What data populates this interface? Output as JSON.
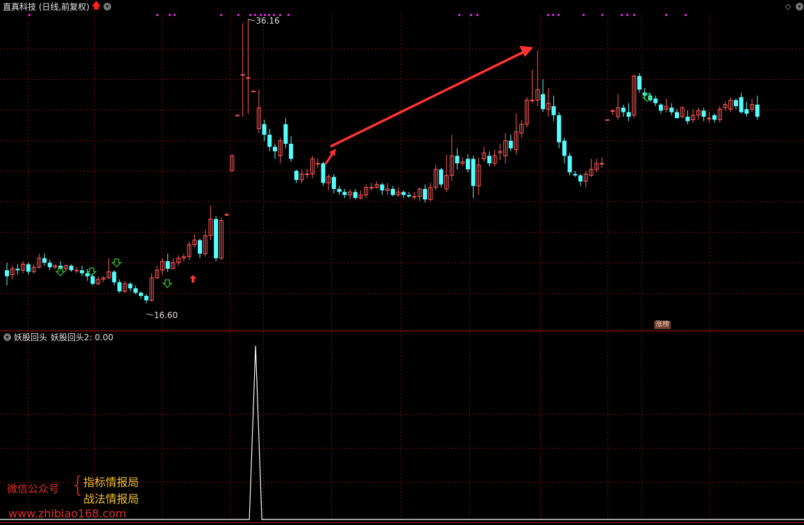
{
  "header": {
    "title": "直真科技 (日线,前复权)",
    "arrow_icon": "red-up-arrow-icon",
    "menu_icon": "circle-chevron-down-icon"
  },
  "subpanel": {
    "title": "妖股回头",
    "value_label": "妖股回头2: 0.00"
  },
  "badge": {
    "label": "涨榜"
  },
  "watermark": {
    "label": "微信公众号",
    "brace": "{",
    "line1": "指标情报局",
    "line2": "战法情报局",
    "url": "www.zhibiao168.com"
  },
  "colors": {
    "up": "#ff5a5a",
    "down": "#54ffff",
    "grid": "#7a1010",
    "separator": "#a01818",
    "arrow": "#ff3333",
    "dots": "#e020e0",
    "green_arrow": "#30d030"
  },
  "chart_data": [
    {
      "type": "candlestick",
      "title": "直真科技 (日线,前复权)",
      "ylim": [
        16.6,
        36.16
      ],
      "annotations": {
        "high": "36.16",
        "low": "16.60"
      },
      "candles": [
        [
          19.5,
          19.1,
          20.0,
          18.5
        ],
        [
          19.2,
          19.6,
          19.8,
          18.9
        ],
        [
          19.6,
          19.5,
          19.9,
          19.2
        ],
        [
          19.5,
          19.9,
          20.1,
          19.3
        ],
        [
          19.9,
          19.4,
          20.0,
          19.2
        ],
        [
          19.4,
          19.7,
          19.9,
          19.3
        ],
        [
          19.7,
          20.3,
          20.6,
          19.6
        ],
        [
          20.3,
          20.0,
          20.6,
          19.8
        ],
        [
          20.0,
          19.7,
          20.2,
          19.5
        ],
        [
          19.7,
          19.8,
          19.9,
          19.6
        ],
        [
          19.8,
          19.6,
          20.1,
          19.5
        ],
        [
          19.6,
          19.8,
          19.9,
          19.4
        ],
        [
          19.8,
          19.5,
          19.9,
          19.4
        ],
        [
          19.5,
          19.5,
          19.7,
          19.3
        ],
        [
          19.5,
          19.3,
          19.8,
          19.1
        ],
        [
          19.3,
          19.1,
          19.6,
          18.8
        ],
        [
          19.1,
          18.6,
          19.3,
          18.5
        ],
        [
          18.6,
          18.9,
          19.1,
          18.5
        ],
        [
          18.9,
          19.0,
          19.1,
          18.7
        ],
        [
          19.0,
          19.4,
          20.3,
          18.9
        ],
        [
          19.4,
          18.7,
          19.5,
          18.5
        ],
        [
          18.7,
          18.1,
          18.9,
          18.0
        ],
        [
          18.1,
          18.6,
          18.8,
          18.0
        ],
        [
          18.6,
          18.3,
          18.7,
          18.1
        ],
        [
          18.3,
          18.0,
          18.5,
          17.9
        ],
        [
          18.0,
          17.8,
          18.1,
          17.6
        ],
        [
          17.8,
          17.5,
          17.9,
          17.3
        ],
        [
          17.5,
          19.0,
          19.3,
          17.4
        ],
        [
          19.0,
          19.5,
          19.8,
          18.9
        ],
        [
          19.5,
          20.1,
          20.3,
          19.2
        ],
        [
          20.1,
          19.6,
          20.6,
          19.4
        ],
        [
          19.6,
          20.0,
          20.3,
          19.6
        ],
        [
          20.0,
          20.3,
          20.5,
          19.8
        ],
        [
          20.3,
          20.4,
          20.6,
          20.1
        ],
        [
          20.4,
          21.2,
          21.4,
          20.2
        ],
        [
          21.2,
          21.5,
          21.9,
          21.0
        ],
        [
          21.5,
          20.6,
          21.6,
          20.3
        ],
        [
          20.6,
          21.8,
          22.2,
          20.4
        ],
        [
          21.8,
          22.9,
          23.8,
          21.5
        ],
        [
          22.9,
          20.3,
          23.1,
          20.1
        ],
        [
          20.3,
          22.8,
          23.0,
          20.2
        ],
        [
          23.2,
          23.2,
          23.3,
          23.1
        ],
        [
          26.1,
          27.1,
          27.2,
          26.1
        ],
        [
          29.8,
          29.8,
          29.8,
          29.8
        ],
        [
          32.5,
          32.5,
          35.9,
          29.7
        ],
        [
          32.3,
          32.3,
          36.16,
          29.9
        ],
        [
          31.4,
          31.4,
          31.4,
          31.4
        ],
        [
          28.9,
          30.3,
          31.5,
          28.6
        ],
        [
          29.2,
          28.5,
          29.5,
          28.1
        ],
        [
          28.5,
          27.7,
          28.9,
          27.4
        ],
        [
          27.7,
          27.4,
          27.9,
          26.9
        ],
        [
          27.1,
          28.1,
          28.3,
          26.6
        ],
        [
          29.2,
          27.9,
          29.6,
          27.6
        ],
        [
          27.9,
          26.9,
          28.4,
          26.7
        ],
        [
          26.1,
          25.5,
          26.2,
          25.3
        ],
        [
          25.5,
          25.9,
          26.2,
          25.3
        ],
        [
          25.9,
          25.9,
          26.2,
          25.6
        ],
        [
          25.9,
          26.9,
          27.1,
          25.6
        ],
        [
          26.6,
          26.6,
          26.9,
          26.3
        ],
        [
          26.6,
          25.3,
          26.7,
          25.1
        ],
        [
          25.3,
          25.7,
          25.9,
          24.8
        ],
        [
          25.7,
          24.9,
          25.9,
          24.6
        ],
        [
          24.9,
          24.7,
          25.1,
          24.5
        ],
        [
          24.7,
          24.5,
          24.9,
          24.3
        ],
        [
          24.5,
          24.7,
          24.9,
          24.2
        ],
        [
          24.7,
          24.3,
          24.9,
          24.2
        ],
        [
          24.3,
          24.5,
          24.8,
          24.2
        ],
        [
          24.5,
          25.0,
          25.2,
          24.3
        ],
        [
          25.0,
          25.0,
          25.3,
          24.8
        ],
        [
          25.0,
          25.2,
          25.4,
          24.9
        ],
        [
          25.2,
          24.8,
          25.3,
          24.5
        ],
        [
          24.8,
          24.9,
          25.3,
          24.5
        ],
        [
          24.9,
          24.5,
          25.1,
          24.4
        ],
        [
          24.5,
          24.7,
          25.0,
          24.4
        ],
        [
          24.7,
          24.5,
          24.8,
          24.3
        ],
        [
          24.5,
          24.4,
          24.7,
          24.3
        ],
        [
          24.4,
          24.4,
          24.7,
          24.2
        ],
        [
          24.4,
          24.9,
          25.0,
          24.1
        ],
        [
          24.9,
          24.2,
          25.2,
          24.0
        ],
        [
          24.2,
          25.0,
          25.3,
          24.1
        ],
        [
          25.0,
          26.2,
          26.5,
          24.8
        ],
        [
          26.2,
          25.2,
          26.3,
          25.0
        ],
        [
          24.9,
          25.8,
          27.2,
          24.7
        ],
        [
          25.8,
          27.1,
          28.5,
          25.4
        ],
        [
          27.1,
          26.6,
          27.6,
          26.2
        ],
        [
          26.6,
          26.7,
          27.0,
          26.4
        ],
        [
          26.9,
          26.2,
          27.2,
          26.0
        ],
        [
          26.9,
          25.1,
          27.1,
          24.3
        ],
        [
          25.1,
          26.5,
          27.0,
          24.5
        ],
        [
          26.9,
          27.3,
          27.7,
          26.7
        ],
        [
          27.1,
          26.6,
          27.4,
          26.4
        ],
        [
          26.6,
          27.1,
          27.5,
          26.4
        ],
        [
          27.3,
          27.4,
          27.9,
          26.8
        ],
        [
          27.1,
          28.1,
          28.6,
          26.6
        ],
        [
          28.1,
          27.6,
          28.5,
          27.4
        ],
        [
          27.5,
          28.7,
          29.9,
          27.2
        ],
        [
          28.6,
          29.2,
          29.5,
          28.3
        ],
        [
          29.2,
          30.8,
          31.0,
          29.0
        ],
        [
          30.8,
          30.8,
          32.8,
          30.6
        ],
        [
          30.8,
          31.5,
          34.1,
          30.4
        ],
        [
          31.2,
          30.2,
          32.2,
          30.0
        ],
        [
          30.2,
          30.6,
          31.6,
          29.7
        ],
        [
          30.4,
          29.8,
          31.1,
          29.4
        ],
        [
          29.8,
          28.0,
          30.0,
          27.6
        ],
        [
          28.1,
          27.1,
          28.3,
          26.6
        ],
        [
          27.1,
          26.0,
          27.3,
          25.8
        ],
        [
          25.9,
          25.8,
          26.1,
          25.7
        ],
        [
          25.8,
          25.4,
          25.9,
          25.1
        ],
        [
          25.4,
          25.9,
          26.1,
          25.0
        ],
        [
          25.8,
          26.2,
          26.9,
          25.7
        ],
        [
          26.2,
          26.6,
          26.9,
          26.0
        ],
        [
          26.6,
          26.6,
          27.0,
          26.3
        ],
        [
          29.5,
          29.5,
          29.5,
          29.5
        ],
        [
          30.1,
          30.1,
          30.2,
          29.8
        ],
        [
          29.7,
          30.3,
          31.2,
          29.5
        ],
        [
          30.3,
          30.0,
          30.5,
          29.7
        ],
        [
          30.0,
          29.7,
          30.6,
          29.4
        ],
        [
          29.8,
          32.4,
          32.5,
          29.6
        ],
        [
          32.4,
          31.5,
          32.6,
          31.3
        ],
        [
          31.3,
          31.1,
          31.6,
          30.8
        ],
        [
          31.1,
          30.8,
          31.3,
          30.7
        ],
        [
          30.9,
          30.6,
          31.1,
          30.4
        ],
        [
          30.5,
          30.1,
          30.6,
          29.9
        ],
        [
          30.2,
          30.4,
          30.9,
          30.0
        ],
        [
          30.3,
          30.0,
          30.6,
          29.8
        ],
        [
          30.0,
          29.6,
          30.2,
          29.6
        ],
        [
          29.7,
          30.3,
          30.4,
          29.6
        ],
        [
          29.7,
          29.4,
          30.1,
          29.2
        ],
        [
          29.5,
          29.8,
          30.2,
          29.3
        ],
        [
          29.8,
          30.1,
          30.3,
          29.5
        ],
        [
          30.1,
          29.7,
          30.3,
          29.4
        ],
        [
          29.6,
          29.6,
          30.0,
          29.3
        ],
        [
          29.8,
          29.5,
          29.9,
          29.3
        ],
        [
          29.5,
          30.2,
          30.4,
          29.3
        ],
        [
          30.3,
          30.5,
          30.7,
          30.1
        ],
        [
          30.2,
          30.8,
          31.0,
          30.0
        ],
        [
          30.8,
          30.4,
          30.9,
          30.2
        ],
        [
          31.0,
          30.0,
          31.3,
          29.9
        ],
        [
          30.2,
          29.9,
          30.7,
          29.7
        ],
        [
          30.2,
          30.5,
          30.9,
          30.0
        ],
        [
          30.5,
          29.7,
          31.1,
          29.5
        ]
      ]
    },
    {
      "type": "line",
      "title": "妖股回头",
      "series": [
        {
          "name": "妖股回头2",
          "peak_index": 46,
          "peak_value": 1,
          "values": "0 except 1 at index 46"
        }
      ]
    }
  ]
}
